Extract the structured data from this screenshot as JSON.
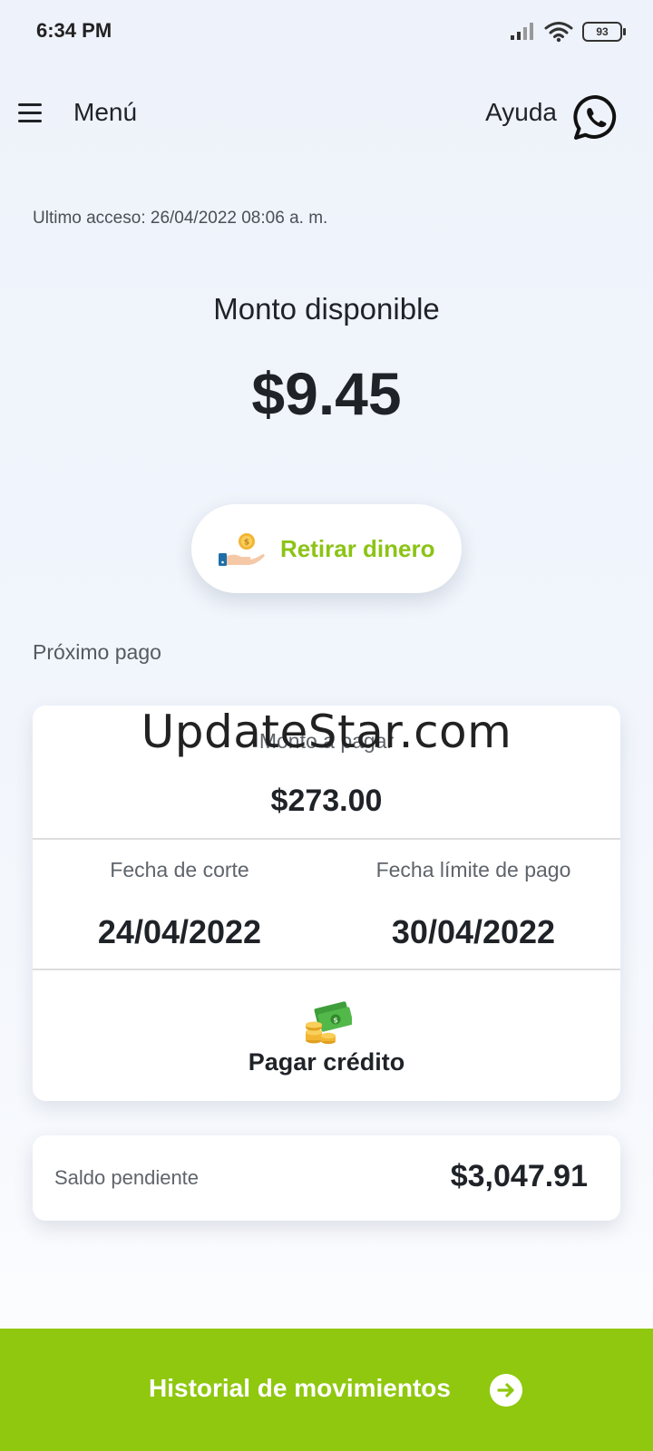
{
  "status_bar": {
    "time": "6:34 PM",
    "battery": "93",
    "icons": [
      "signal-icon",
      "wifi-icon",
      "battery-icon"
    ]
  },
  "header": {
    "menu_label": "Menú",
    "help_label": "Ayuda",
    "help_icon": "whatsapp-icon"
  },
  "last_access": "Ultimo acceso: 26/04/2022 08:06 a. m.",
  "available": {
    "label": "Monto disponible",
    "amount": "$9.45"
  },
  "withdraw": {
    "label": "Retirar dinero",
    "icon": "hand-coin-icon"
  },
  "next_payment": {
    "section_label": "Próximo pago",
    "amount_label": "Monto a pagar",
    "amount": "$273.00",
    "cut_date_label": "Fecha de corte",
    "cut_date": "24/04/2022",
    "limit_date_label": "Fecha límite de pago",
    "limit_date": "30/04/2022",
    "pay_label": "Pagar crédito",
    "pay_icon": "money-icon"
  },
  "watermark": "UpdateStar.com",
  "balance": {
    "label": "Saldo pendiente",
    "amount": "$3,047.91"
  },
  "history": {
    "label": "Historial de movimientos",
    "icon": "arrow-right-icon"
  },
  "colors": {
    "accent_green": "#8fc80f",
    "text_green": "#8cc315",
    "background": "#eef2fa"
  }
}
